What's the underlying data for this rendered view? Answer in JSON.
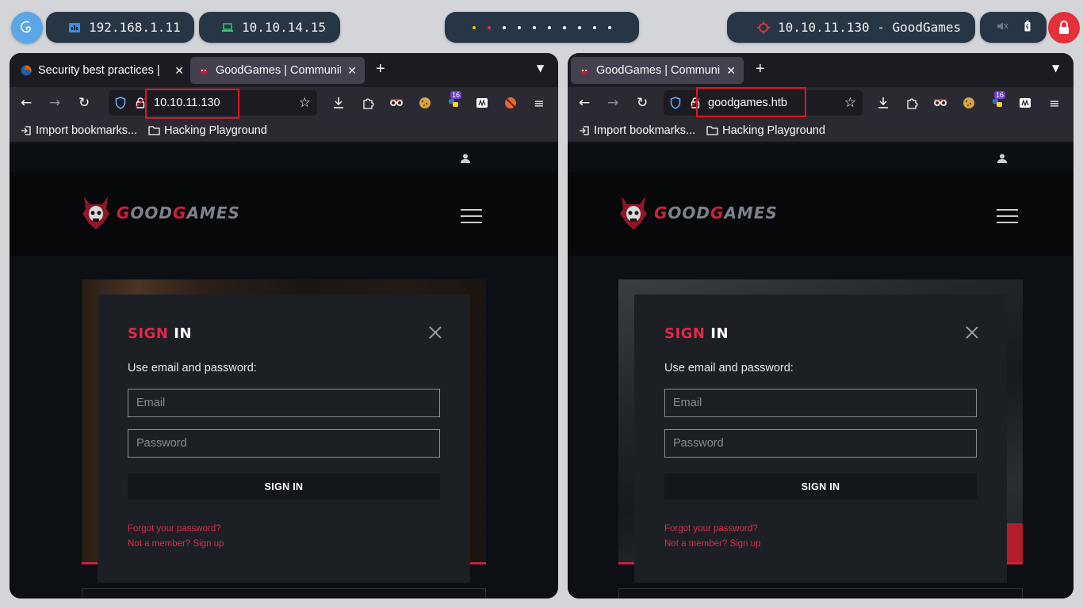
{
  "topbar": {
    "host_ip": "192.168.1.11",
    "vpn_ip": "10.10.14.15",
    "target": "10.10.11.130 - GoodGames",
    "colors": {
      "pill": "#283545",
      "accent": "#5aa6e6",
      "lock": "#e3303a"
    },
    "workspace_dots": [
      "#f5c400",
      "#e3303a",
      "#ffffff",
      "#ffffff",
      "#ffffff",
      "#ffffff",
      "#ffffff",
      "#ffffff",
      "#ffffff",
      "#ffffff"
    ]
  },
  "left": {
    "tabs": [
      {
        "label": "Security best practices |",
        "icon": "firefox-icon"
      },
      {
        "label": "GoodGames | Communit",
        "icon": "goodgames-favicon"
      }
    ],
    "url": "10.10.11.130",
    "bookmarks": [
      "Import bookmarks...",
      "Hacking Playground"
    ],
    "badge": "16"
  },
  "right": {
    "tabs": [
      {
        "label": "GoodGames | Communit",
        "icon": "goodgames-favicon"
      }
    ],
    "url": "goodgames.htb",
    "bookmarks": [
      "Import bookmarks...",
      "Hacking Playground"
    ],
    "badge": "16"
  },
  "site": {
    "brand": {
      "first": "G",
      "mid": "OOD",
      "second": "G",
      "rest": "AMES"
    },
    "modal": {
      "title_red": "SIGN",
      "title_white": "IN",
      "subtitle": "Use email and password:",
      "email_placeholder": "Email",
      "password_placeholder": "Password",
      "submit": "SIGN IN",
      "forgot": "Forgot your password?",
      "signup": "Not a member? Sign up"
    }
  }
}
